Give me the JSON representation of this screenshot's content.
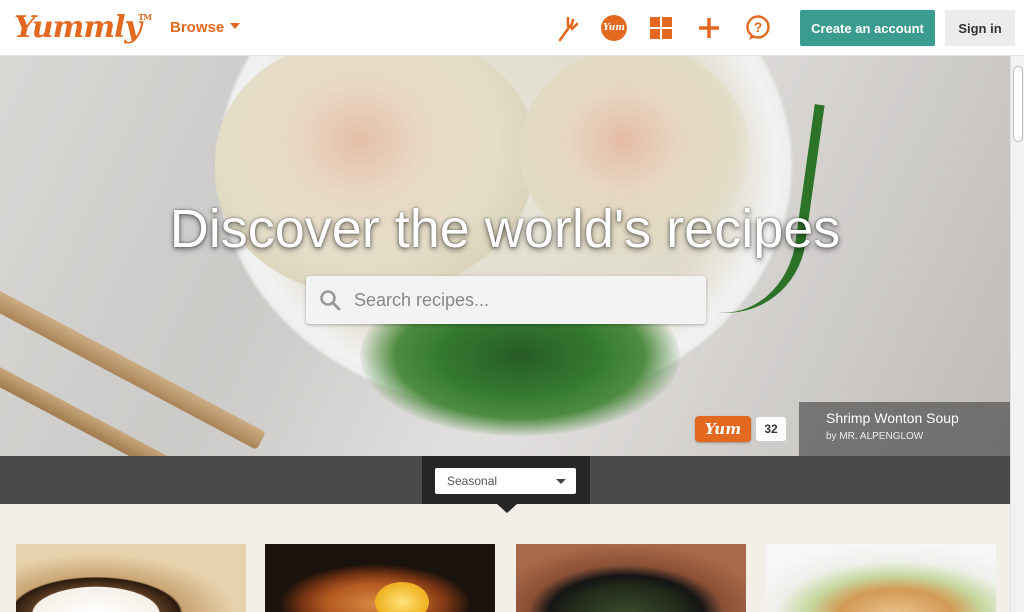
{
  "header": {
    "logo": "Yummly",
    "logo_tm": "TM",
    "browse_label": "Browse",
    "icons": [
      "fork-icon",
      "yum-icon",
      "grid-icon",
      "plus-icon",
      "help-icon"
    ],
    "yum_icon_text": "Yum",
    "create_account_label": "Create an account",
    "sign_in_label": "Sign in"
  },
  "hero": {
    "title": "Discover the world's recipes",
    "search_placeholder": "Search recipes...",
    "yum_badge": "Yum",
    "yum_count": "32",
    "recipe_name": "Shrimp Wonton Soup",
    "recipe_author": "by MR. ALPENGLOW"
  },
  "filter": {
    "selected": "Seasonal"
  },
  "colors": {
    "brand_orange": "#e2691f",
    "teal_button": "#3a9b8f",
    "strip_dark": "#4a4a4a"
  }
}
